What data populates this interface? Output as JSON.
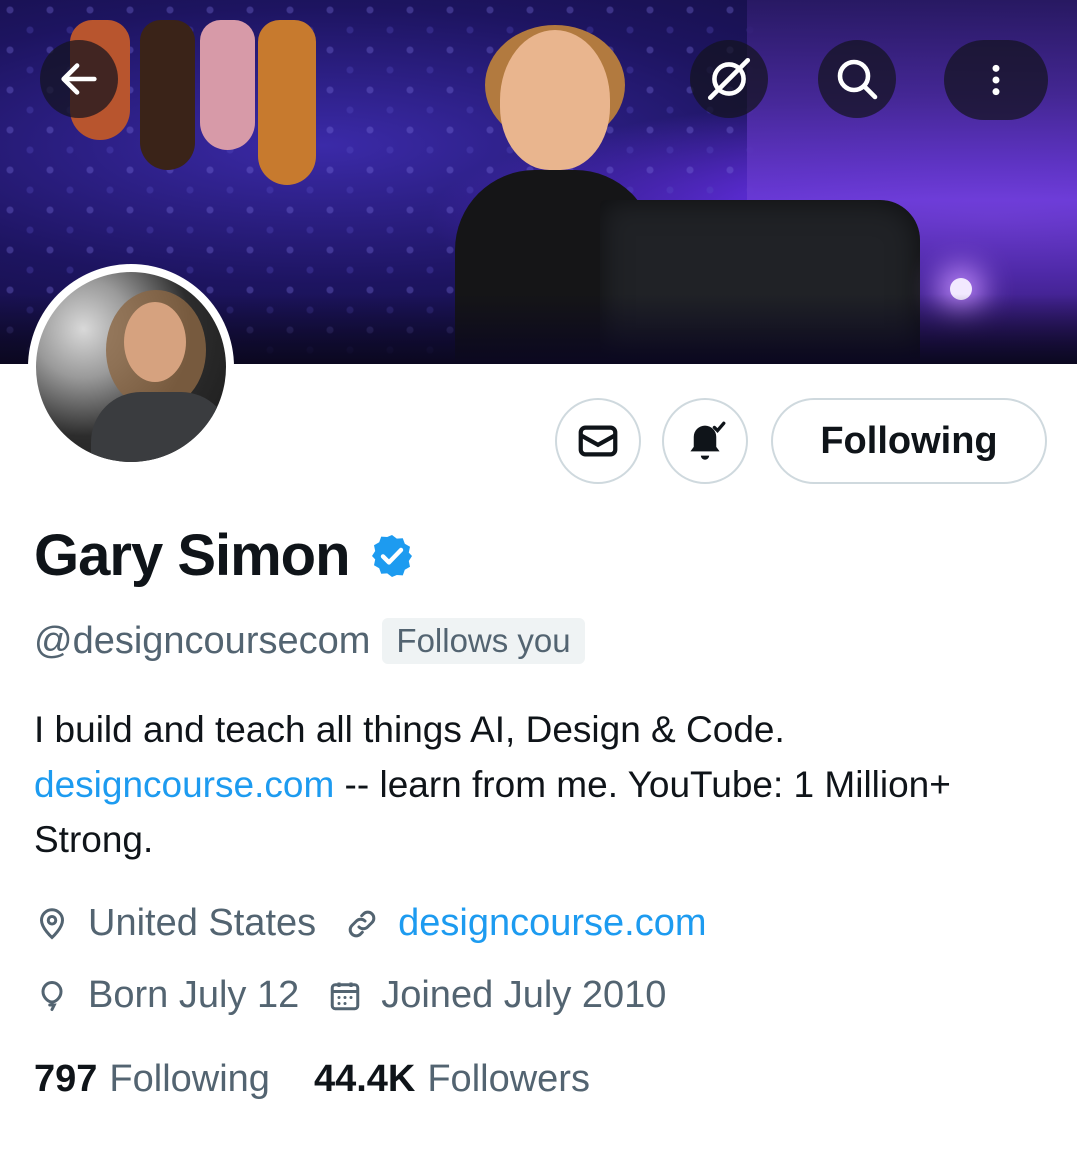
{
  "header": {
    "back_icon": "arrow-left-icon",
    "grok_icon": "grok-icon",
    "search_icon": "search-icon",
    "more_icon": "more-vertical-icon"
  },
  "profile": {
    "name": "Gary Simon",
    "verified_color": "#1d9bf0",
    "handle": "@designcoursecom",
    "follows_you": "Follows you",
    "bio_line1": "I build and teach all things AI, Design & Code.",
    "bio_link": "designcourse.com",
    "bio_rest": " -- learn from me. YouTube: 1 Million+ Strong.",
    "location": "United States",
    "website": "designcourse.com",
    "born": "Born July 12",
    "joined": "Joined July 2010"
  },
  "actions": {
    "message_icon": "mail-icon",
    "notify_icon": "bell-check-icon",
    "following_label": "Following"
  },
  "stats": {
    "following_count": "797",
    "following_label": "Following",
    "followers_count": "44.4K",
    "followers_label": "Followers"
  },
  "colors": {
    "text_primary": "#0f1419",
    "text_secondary": "#536471",
    "link": "#1d9bf0",
    "border": "#cfd9de"
  }
}
